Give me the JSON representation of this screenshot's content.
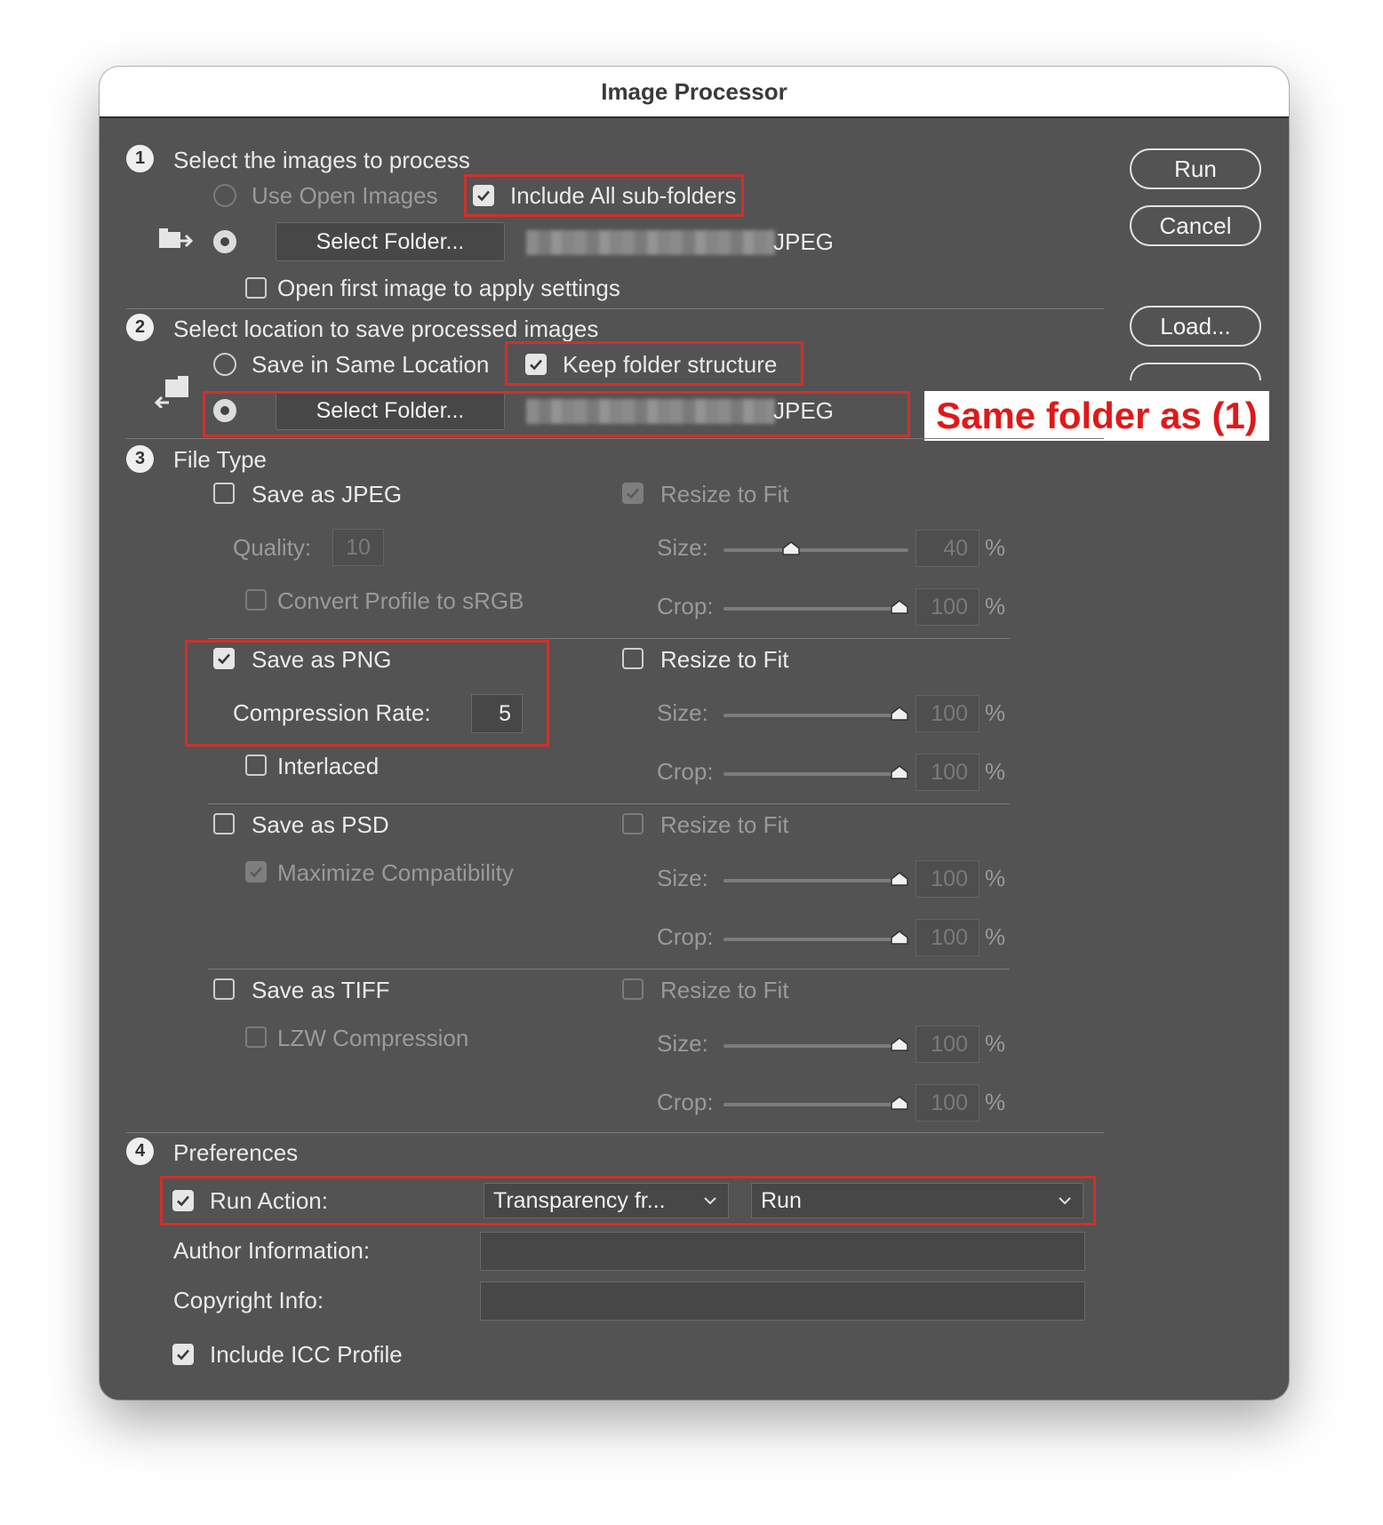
{
  "window": {
    "title": "Image Processor"
  },
  "buttons": {
    "run": "Run",
    "cancel": "Cancel",
    "load": "Load..."
  },
  "section1": {
    "step": "1",
    "title": "Select the images to process",
    "use_open_images": "Use Open Images",
    "include_subfolders": "Include All sub-folders",
    "select_folder": "Select Folder...",
    "folder_path_suffix": "JPEG",
    "open_first_image": "Open first image to apply settings"
  },
  "section2": {
    "step": "2",
    "title": "Select location to save processed images",
    "save_same_location": "Save in Same Location",
    "keep_folder_structure": "Keep folder structure",
    "select_folder": "Select Folder...",
    "folder_path_suffix": "JPEG"
  },
  "annotation": "Same folder as (1)",
  "section3": {
    "step": "3",
    "title": "File Type",
    "jpeg": {
      "label": "Save as JPEG",
      "checked": false,
      "quality_label": "Quality:",
      "quality_value": "10",
      "convert_profile": "Convert Profile to sRGB",
      "resize": "Resize to Fit",
      "resize_checked": true,
      "size_label": "Size:",
      "size_value": "40",
      "crop_label": "Crop:",
      "crop_value": "100",
      "unit": "%"
    },
    "png": {
      "label": "Save as PNG",
      "checked": true,
      "compression_label": "Compression Rate:",
      "compression_value": "5",
      "interlaced": "Interlaced",
      "resize": "Resize to Fit",
      "resize_checked": false,
      "size_label": "Size:",
      "size_value": "100",
      "crop_label": "Crop:",
      "crop_value": "100",
      "unit": "%"
    },
    "psd": {
      "label": "Save as PSD",
      "checked": false,
      "maximize": "Maximize Compatibility",
      "resize": "Resize to Fit",
      "resize_checked": false,
      "size_label": "Size:",
      "size_value": "100",
      "crop_label": "Crop:",
      "crop_value": "100",
      "unit": "%"
    },
    "tiff": {
      "label": "Save as TIFF",
      "checked": false,
      "lzw": "LZW Compression",
      "resize": "Resize to Fit",
      "resize_checked": false,
      "size_label": "Size:",
      "size_value": "100",
      "crop_label": "Crop:",
      "crop_value": "100",
      "unit": "%"
    }
  },
  "section4": {
    "step": "4",
    "title": "Preferences",
    "run_action": "Run Action:",
    "action_set": "Transparency fr...",
    "action": "Run",
    "author_label": "Author Information:",
    "author_value": "",
    "copyright_label": "Copyright Info:",
    "copyright_value": "",
    "include_icc": "Include ICC Profile"
  },
  "colors": {
    "dialog_bg": "#535353",
    "annotation_red": "#d1302a"
  },
  "icons": [
    "folder-arrow-icon",
    "checkmark-icon",
    "chevron-down-icon",
    "slider-thumb-icon"
  ]
}
